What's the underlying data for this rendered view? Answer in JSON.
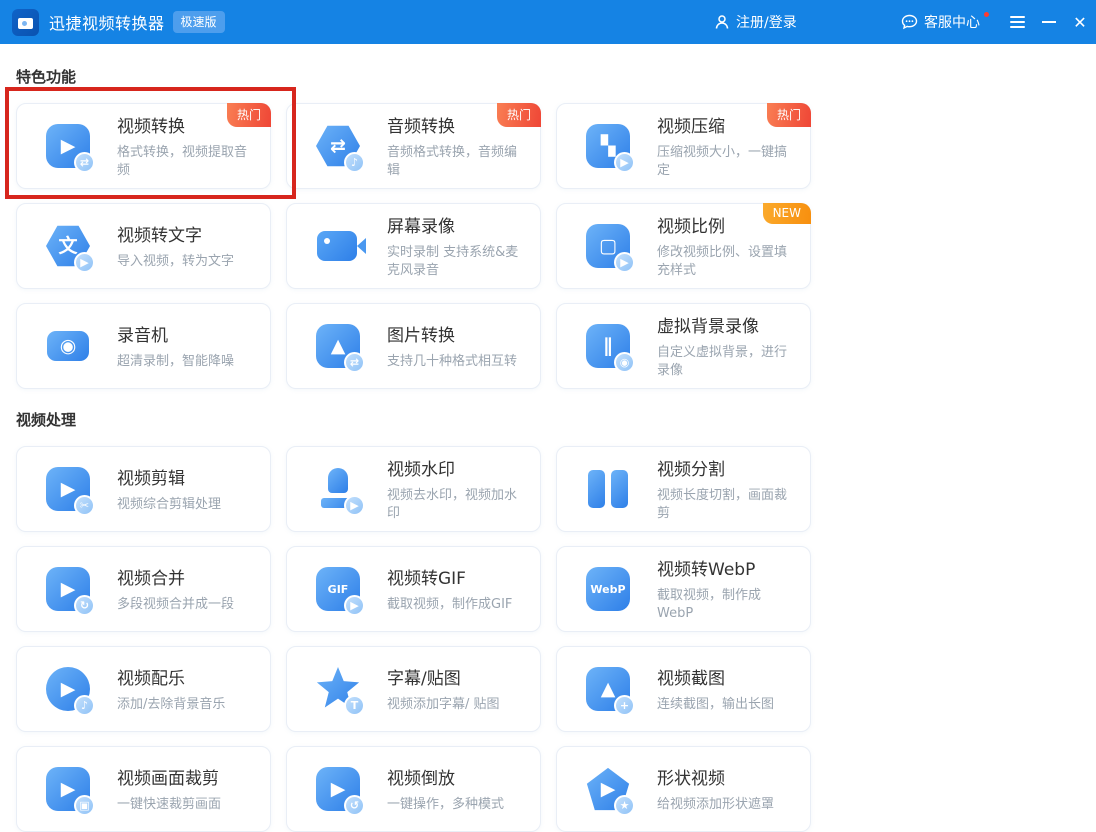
{
  "window": {
    "title": "迅捷视频转换器",
    "edition_badge": "极速版",
    "login_label": "注册/登录",
    "support_label": "客服中心",
    "icons": {
      "app": "app-logo-camera-icon",
      "user": "user-icon",
      "chat": "chat-bubble-icon",
      "menu": "hamburger-menu-icon",
      "minimize": "minimize-icon",
      "close": "close-icon",
      "notification_dot": "red-notification-dot"
    },
    "colors": {
      "titlebar": "#1583e4",
      "accent_blue": "#2e7fe8",
      "hot_badge": "#ef4636",
      "new_badge": "#f78f0e",
      "highlight_box": "#d7261d"
    }
  },
  "close_glyph": "✕",
  "sections": [
    {
      "title": "特色功能",
      "cards": [
        {
          "title": "视频转换",
          "subtitle": "格式转换，视频提取音频",
          "badge": "热门",
          "badge_type": "hot",
          "icon": "video-convert-icon",
          "shape": "rsq",
          "glyph": "▶",
          "mini": "⇄",
          "highlighted": true
        },
        {
          "title": "音频转换",
          "subtitle": "音频格式转换，音频编辑",
          "badge": "热门",
          "badge_type": "hot",
          "icon": "audio-convert-icon",
          "shape": "hex",
          "glyph": "⇄",
          "mini": "♪"
        },
        {
          "title": "视频压缩",
          "subtitle": "压缩视频大小，一键搞定",
          "badge": "热门",
          "badge_type": "hot",
          "icon": "video-compress-icon",
          "shape": "rsq",
          "glyph": "▚",
          "mini": "▶"
        },
        {
          "title": "视频转文字",
          "subtitle": "导入视频，转为文字",
          "icon": "video-to-text-icon",
          "shape": "hex",
          "glyph": "文",
          "mini": "▶"
        },
        {
          "title": "屏幕录像",
          "subtitle": "实时录制 支持系统&麦克风录音",
          "icon": "screen-record-icon",
          "shape": "camcorder",
          "glyph": ""
        },
        {
          "title": "视频比例",
          "subtitle": "修改视频比例、设置填充样式",
          "badge": "NEW",
          "badge_type": "new",
          "icon": "aspect-ratio-icon",
          "shape": "rsq",
          "glyph": "▢",
          "mini": "▶"
        },
        {
          "title": "录音机",
          "subtitle": "超清录制，智能降噪",
          "icon": "voice-recorder-icon",
          "shape": "radio",
          "glyph": "◉"
        },
        {
          "title": "图片转换",
          "subtitle": "支持几十种格式相互转",
          "icon": "image-convert-icon",
          "shape": "rsq",
          "glyph": "▲",
          "mini": "⇄"
        },
        {
          "title": "虚拟背景录像",
          "subtitle": "自定义虚拟背景，进行录像",
          "icon": "virtual-background-record-icon",
          "shape": "rsq",
          "glyph": "∥",
          "mini": "◉"
        }
      ]
    },
    {
      "title": "视频处理",
      "cards": [
        {
          "title": "视频剪辑",
          "subtitle": "视频综合剪辑处理",
          "icon": "video-edit-icon",
          "shape": "rsq",
          "glyph": "▶",
          "mini": "✂"
        },
        {
          "title": "视频水印",
          "subtitle": "视频去水印，视频加水印",
          "icon": "video-watermark-icon",
          "shape": "stamp",
          "glyph": "",
          "mini": "▶"
        },
        {
          "title": "视频分割",
          "subtitle": "视频长度切割，画面裁剪",
          "icon": "video-split-icon",
          "shape": "split",
          "glyph": ""
        },
        {
          "title": "视频合并",
          "subtitle": "多段视频合并成一段",
          "icon": "video-merge-icon",
          "shape": "rsq",
          "glyph": "▶",
          "mini": "↻"
        },
        {
          "title": "视频转GIF",
          "subtitle": "截取视频，制作成GIF",
          "icon": "video-to-gif-icon",
          "shape": "rsq",
          "glyph": "GIF",
          "mini": "▶"
        },
        {
          "title": "视频转WebP",
          "subtitle": "截取视频，制作成WebP",
          "icon": "video-to-webp-icon",
          "shape": "rsq",
          "glyph": "WebP"
        },
        {
          "title": "视频配乐",
          "subtitle": "添加/去除背景音乐",
          "icon": "video-music-icon",
          "shape": "circle",
          "glyph": "▶",
          "mini": "♪"
        },
        {
          "title": "字幕/贴图",
          "subtitle": "视频添加字幕/ 贴图",
          "icon": "subtitle-sticker-icon",
          "shape": "star",
          "glyph": "",
          "mini": "T"
        },
        {
          "title": "视频截图",
          "subtitle": "连续截图，输出长图",
          "icon": "video-screenshot-icon",
          "shape": "rsq",
          "glyph": "▲",
          "mini": "+"
        },
        {
          "title": "视频画面裁剪",
          "subtitle": "一键快速裁剪画面",
          "icon": "video-crop-icon",
          "shape": "rsq",
          "glyph": "▶",
          "mini": "▣"
        },
        {
          "title": "视频倒放",
          "subtitle": "一键操作，多种模式",
          "icon": "video-reverse-icon",
          "shape": "rsq",
          "glyph": "▶",
          "mini": "↺"
        },
        {
          "title": "形状视频",
          "subtitle": "给视频添加形状遮罩",
          "icon": "shape-video-icon",
          "shape": "pent",
          "glyph": "▶",
          "mini": "★"
        }
      ]
    }
  ]
}
